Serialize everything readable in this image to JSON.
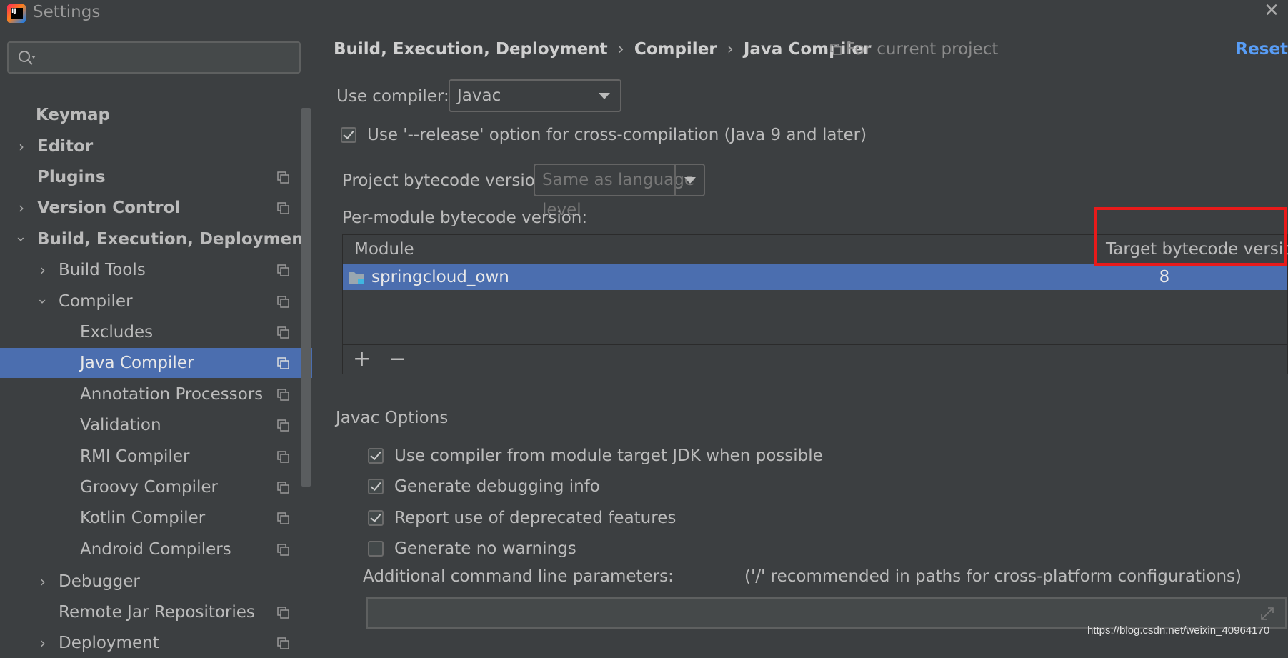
{
  "window": {
    "title": "Settings"
  },
  "sidebar": {
    "search": {
      "value": "",
      "placeholder": ""
    },
    "items": [
      {
        "label": "Keymap"
      },
      {
        "label": "Editor"
      },
      {
        "label": "Plugins"
      },
      {
        "label": "Version Control"
      },
      {
        "label": "Build, Execution, Deployment"
      },
      {
        "label": "Build Tools"
      },
      {
        "label": "Compiler"
      },
      {
        "label": "Excludes"
      },
      {
        "label": "Java Compiler"
      },
      {
        "label": "Annotation Processors"
      },
      {
        "label": "Validation"
      },
      {
        "label": "RMI Compiler"
      },
      {
        "label": "Groovy Compiler"
      },
      {
        "label": "Kotlin Compiler"
      },
      {
        "label": "Android Compilers"
      },
      {
        "label": "Debugger"
      },
      {
        "label": "Remote Jar Repositories"
      },
      {
        "label": "Deployment"
      }
    ]
  },
  "header": {
    "breadcrumb": [
      "Build, Execution, Deployment",
      "Compiler",
      "Java Compiler"
    ],
    "breadcrumb_sep": "›",
    "scope": "For current project",
    "reset": "Reset"
  },
  "compiler": {
    "use_compiler_label": "Use compiler:",
    "use_compiler_value": "Javac",
    "release_option": "Use '--release' option for cross-compilation (Java 9 and later)",
    "project_bytecode_label": "Project bytecode version:",
    "project_bytecode_value": "Same as language level",
    "per_module_label": "Per-module bytecode version:"
  },
  "module_table": {
    "headers": [
      "Module",
      "Target bytecode version"
    ],
    "rows": [
      {
        "module": "springcloud_own",
        "version": "8"
      }
    ],
    "add": "+",
    "remove": "−"
  },
  "javac_options": {
    "title": "Javac Options",
    "options": [
      {
        "label": "Use compiler from module target JDK when possible",
        "checked": true
      },
      {
        "label": "Generate debugging info",
        "checked": true
      },
      {
        "label": "Report use of deprecated features",
        "checked": true
      },
      {
        "label": "Generate no warnings",
        "checked": false
      }
    ],
    "params_label": "Additional command line parameters:",
    "params_hint": "('/' recommended in paths for cross-platform configurations)",
    "params_value": ""
  },
  "watermark": "https://blog.csdn.net/weixin_40964170",
  "colors": {
    "selection": "#4b6eaf",
    "link": "#589df6",
    "highlight_box": "#e81a1a",
    "background": "#3c3f41"
  }
}
